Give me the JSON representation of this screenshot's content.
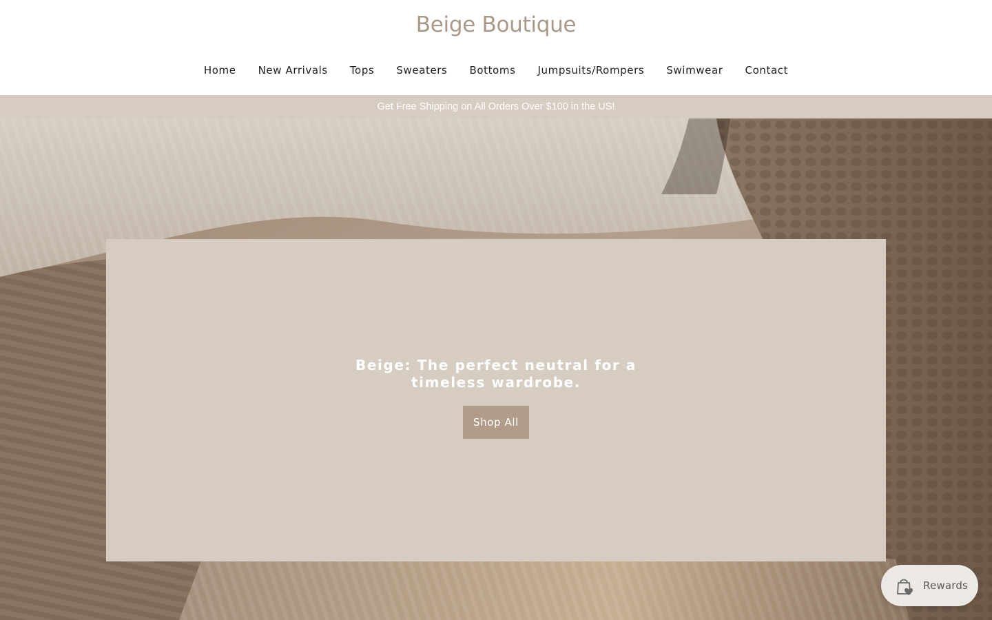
{
  "header": {
    "logo": "Beige Boutique",
    "nav": [
      "Home",
      "New Arrivals",
      "Tops",
      "Sweaters",
      "Bottoms",
      "Jumpsuits/Rompers",
      "Swimwear",
      "Contact"
    ]
  },
  "announcement": {
    "text": "Get Free Shipping on All Orders Over $100 in the US!"
  },
  "hero": {
    "heading": "Beige: The perfect neutral for a timeless wardrobe.",
    "cta_label": "Shop All"
  },
  "rewards": {
    "label": "Rewards",
    "icon": "shopping-bag-heart-icon"
  },
  "colors": {
    "logo": "#a89888",
    "announcement_bg": "#d6ccc2",
    "panel_bg": "#d6ccc2",
    "button_bg": "#b09c89",
    "nav_text": "#1e1e1e"
  }
}
